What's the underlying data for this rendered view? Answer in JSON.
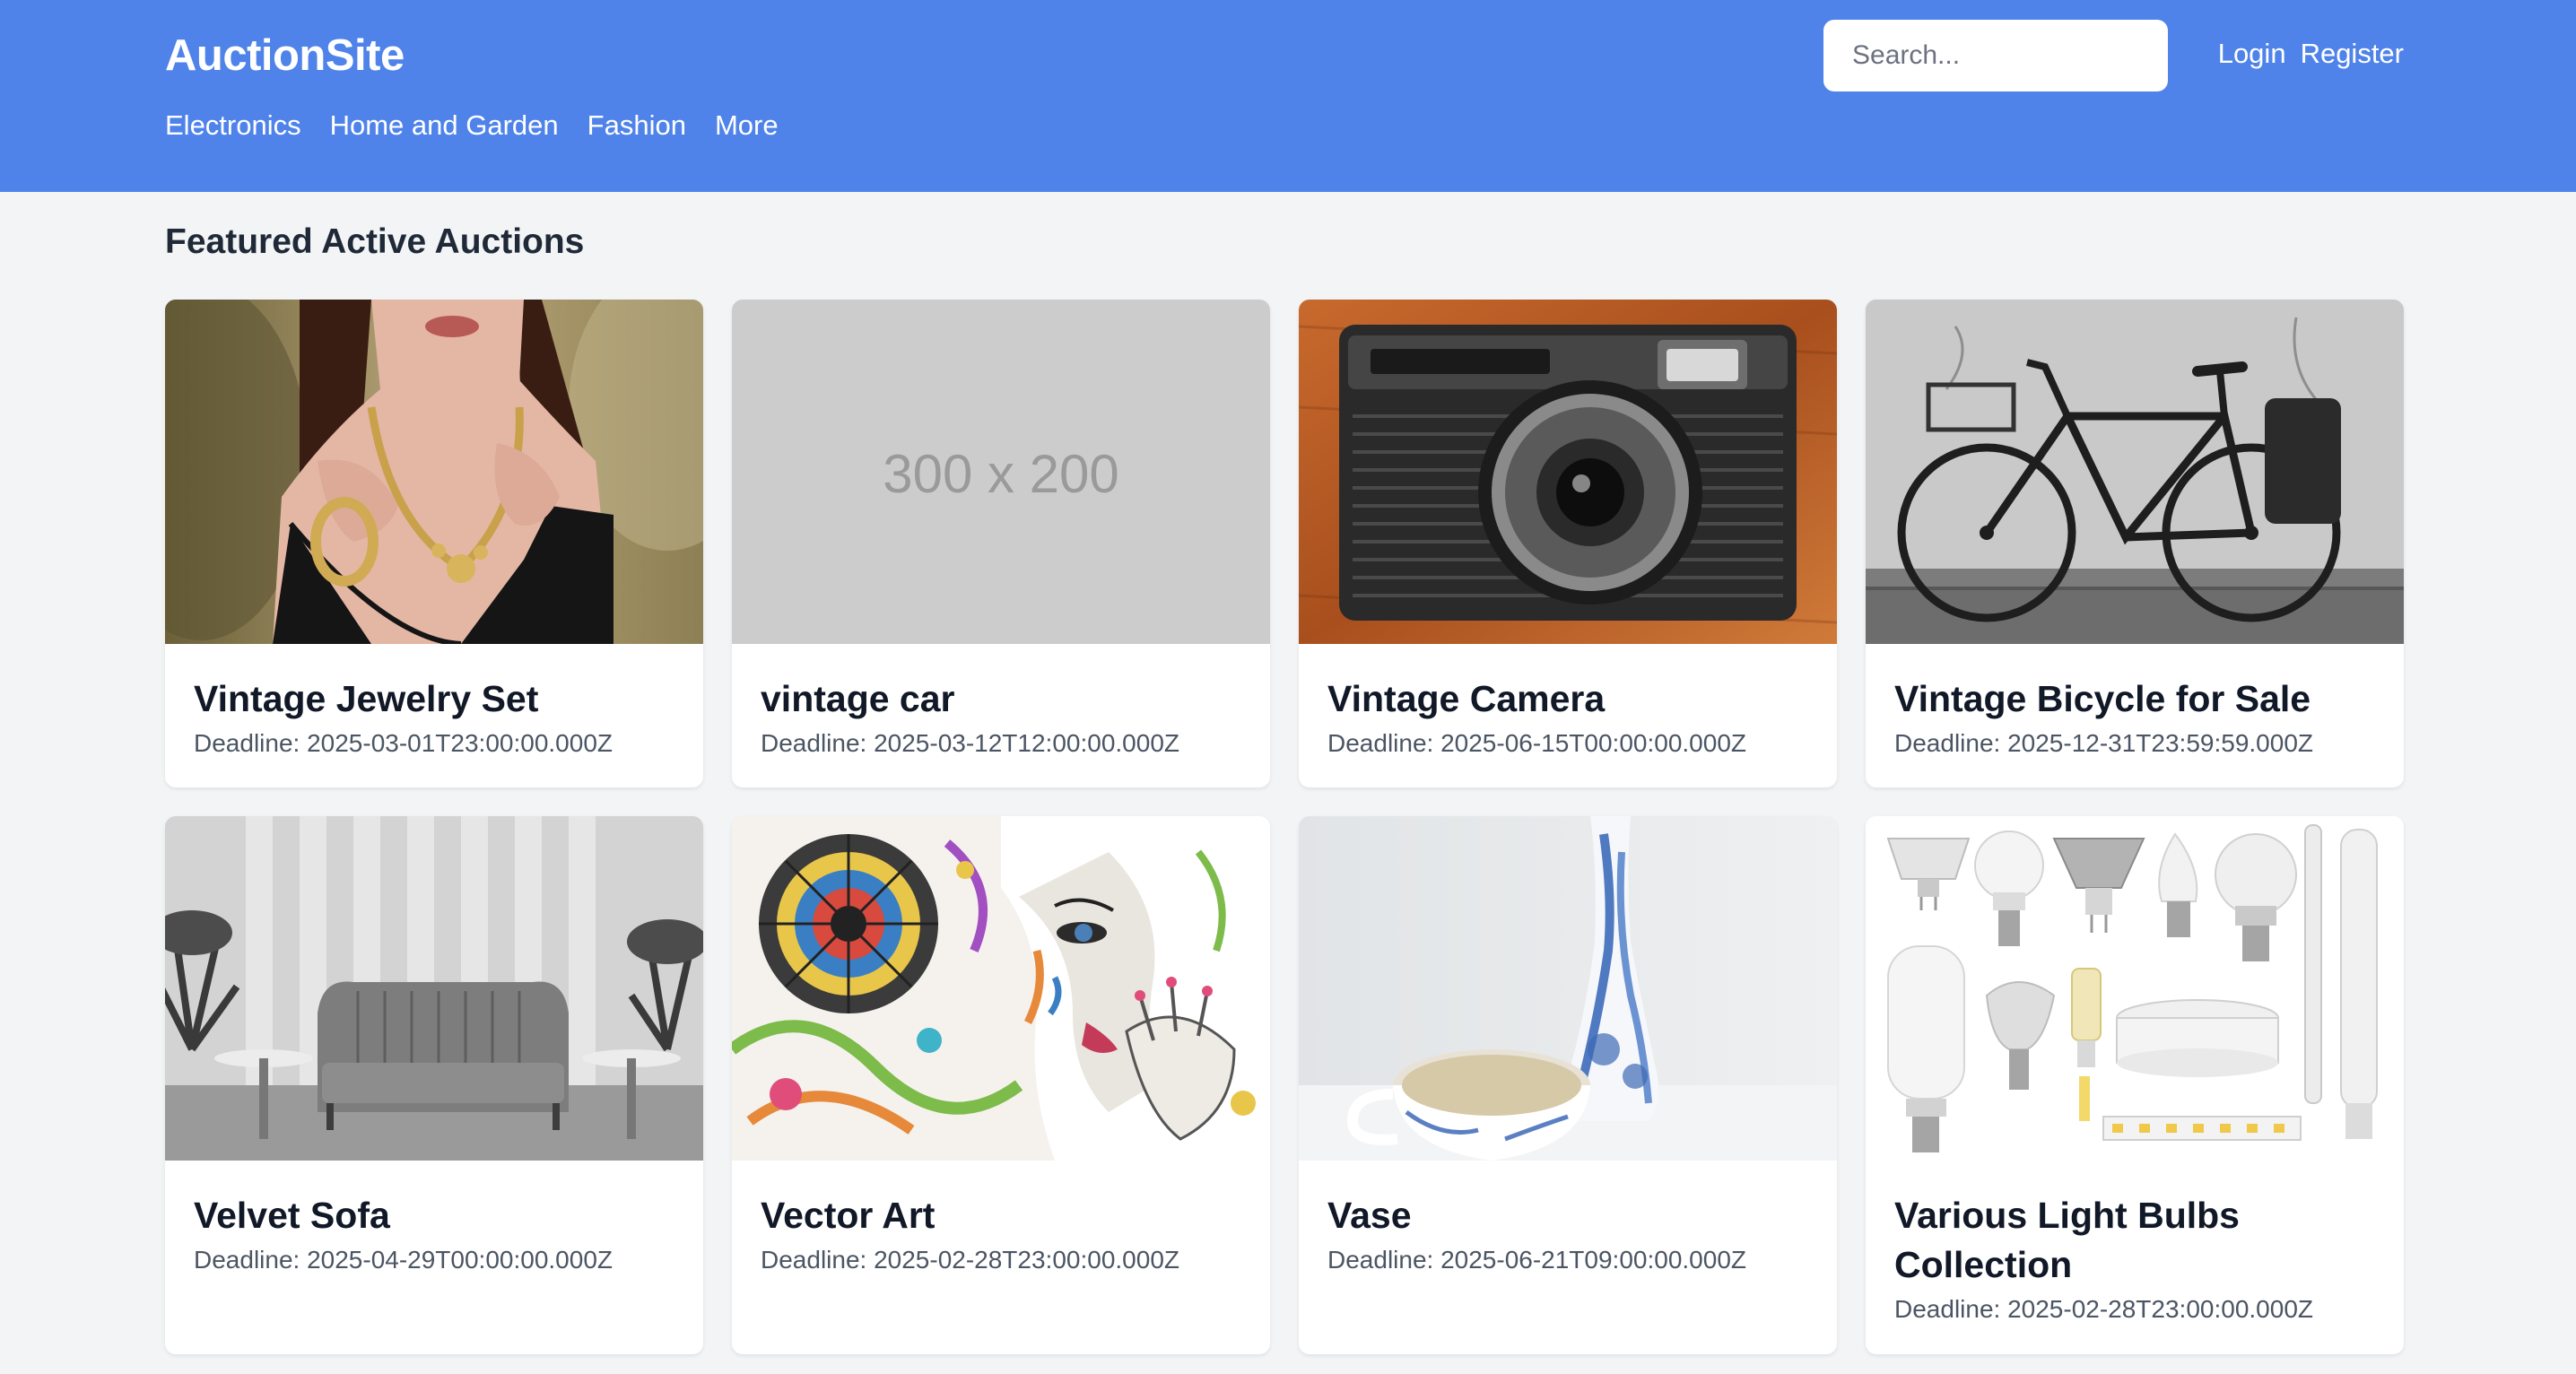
{
  "header": {
    "brand": "AuctionSite",
    "nav": [
      "Electronics",
      "Home and Garden",
      "Fashion",
      "More"
    ],
    "search_placeholder": "Search...",
    "login": "Login",
    "register": "Register",
    "bg_color": "#4f83ea"
  },
  "main": {
    "section_title": "Featured Active Auctions",
    "deadline_label": "Deadline:",
    "placeholder_image_text": "300 x 200",
    "auctions": [
      {
        "title": "Vintage Jewelry Set",
        "deadline": "Deadline: 2025-03-01T23:00:00.000Z",
        "image": "jewelry-photo"
      },
      {
        "title": "vintage car",
        "deadline": "Deadline: 2025-03-12T12:00:00.000Z",
        "image": "placeholder-image"
      },
      {
        "title": "Vintage Camera",
        "deadline": "Deadline: 2025-06-15T00:00:00.000Z",
        "image": "camera-photo"
      },
      {
        "title": "Vintage Bicycle for Sale",
        "deadline": "Deadline: 2025-12-31T23:59:59.000Z",
        "image": "bicycle-photo"
      },
      {
        "title": "Velvet Sofa",
        "deadline": "Deadline: 2025-04-29T00:00:00.000Z",
        "image": "sofa-photo"
      },
      {
        "title": "Vector Art",
        "deadline": "Deadline: 2025-02-28T23:00:00.000Z",
        "image": "vector-art-image"
      },
      {
        "title": "Vase",
        "deadline": "Deadline: 2025-06-21T09:00:00.000Z",
        "image": "vase-photo"
      },
      {
        "title": "Various Light Bulbs Collection",
        "deadline": "Deadline: 2025-02-28T23:00:00.000Z",
        "image": "light-bulbs-photo"
      }
    ]
  }
}
